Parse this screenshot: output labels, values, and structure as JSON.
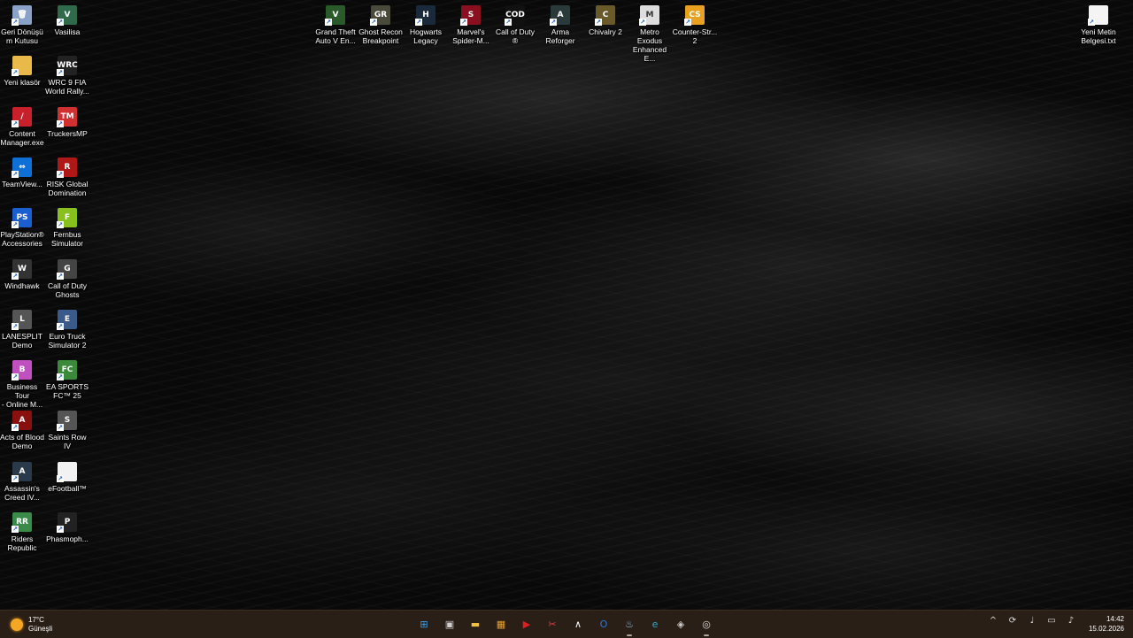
{
  "desktop_icons": [
    {
      "name": "recycle-bin-icon",
      "label": "Geri Dönüşü\nm Kutusu",
      "color": "#8aa2c8",
      "glyph": "🗑"
    },
    {
      "name": "vasilisa-icon",
      "label": "Vasilisa",
      "color": "#2f6b4a",
      "glyph": "V"
    },
    {
      "name": "folder-icon",
      "label": "Yeni klasör",
      "color": "#e9b949",
      "glyph": ""
    },
    {
      "name": "wrc9-icon",
      "label": "WRC 9 FIA\nWorld Rally...",
      "color": "#222",
      "glyph": "WRC"
    },
    {
      "name": "content-manager-icon",
      "label": "Content\nManager.exe",
      "color": "#c8202a",
      "glyph": "/"
    },
    {
      "name": "truckersmp-icon",
      "label": "TruckersMP",
      "color": "#d03030",
      "glyph": "TM"
    },
    {
      "name": "teamviewer-icon",
      "label": "TeamView...",
      "color": "#0e6fd6",
      "glyph": "⇔"
    },
    {
      "name": "risk-icon",
      "label": "RISK Global\nDomination",
      "color": "#b01818",
      "glyph": "R"
    },
    {
      "name": "playstation-accessories-icon",
      "label": "PlayStation®\nAccessories",
      "color": "#1a5fd0",
      "glyph": "PS"
    },
    {
      "name": "fernbus-icon",
      "label": "Fernbus\nSimulator",
      "color": "#88c020",
      "glyph": "F"
    },
    {
      "name": "windhawk-icon",
      "label": "Windhawk",
      "color": "#333",
      "glyph": "W"
    },
    {
      "name": "cod-ghosts-icon",
      "label": "Call of Duty\nGhosts",
      "color": "#444",
      "glyph": "G"
    },
    {
      "name": "lanesplit-icon",
      "label": "LANESPLIT\nDemo",
      "color": "#555",
      "glyph": "L"
    },
    {
      "name": "ets2-icon",
      "label": "Euro Truck\nSimulator 2",
      "color": "#3a5a8a",
      "glyph": "E"
    },
    {
      "name": "business-tour-icon",
      "label": "Business Tour\n- Online M...",
      "color": "#c050c0",
      "glyph": "B"
    },
    {
      "name": "ea-fc25-icon",
      "label": "EA SPORTS\nFC™ 25",
      "color": "#3a8a3a",
      "glyph": "FC"
    },
    {
      "name": "acts-of-blood-icon",
      "label": "Acts of Blood\nDemo",
      "color": "#8a1010",
      "glyph": "A"
    },
    {
      "name": "saints-row-icon",
      "label": "Saints Row IV",
      "color": "#555",
      "glyph": "S"
    },
    {
      "name": "assassins-creed-icon",
      "label": "Assassin's\nCreed IV...",
      "color": "#2a3a4a",
      "glyph": "A"
    },
    {
      "name": "efootball-icon",
      "label": "eFootball™",
      "color": "#f2f2f2",
      "glyph": ""
    },
    {
      "name": "riders-republic-icon",
      "label": "Riders\nRepublic",
      "color": "#3a8a4a",
      "glyph": "RR"
    },
    {
      "name": "phasmophobia-icon",
      "label": "Phasmoph...",
      "color": "#222",
      "glyph": "P"
    }
  ],
  "top_icons": [
    {
      "name": "gta5-icon",
      "label": "Grand Theft\nAuto V En...",
      "color": "#2a5a2a",
      "glyph": "V"
    },
    {
      "name": "ghost-recon-icon",
      "label": "Ghost Recon\nBreakpoint",
      "color": "#4a4a3a",
      "glyph": "GR"
    },
    {
      "name": "hogwarts-icon",
      "label": "Hogwarts\nLegacy",
      "color": "#1a2a3a",
      "glyph": "H"
    },
    {
      "name": "spiderman-icon",
      "label": "Marvel's\nSpider-M...",
      "color": "#8a1020",
      "glyph": "S"
    },
    {
      "name": "cod-icon",
      "label": "Call of Duty\n®",
      "color": "#111",
      "glyph": "COD"
    },
    {
      "name": "arma-icon",
      "label": "Arma\nReforger",
      "color": "#2a3a3a",
      "glyph": "A"
    },
    {
      "name": "chivalry-icon",
      "label": "Chivalry 2",
      "color": "#6a5a2a",
      "glyph": "C"
    },
    {
      "name": "metro-exodus-icon",
      "label": "Metro Exodus\nEnhanced E...",
      "color": "#ddd",
      "glyph": "M"
    },
    {
      "name": "cs2-icon",
      "label": "Counter-Str...\n2",
      "color": "#e8a020",
      "glyph": "CS"
    }
  ],
  "right_icons": [
    {
      "name": "text-file-icon",
      "label": "Yeni Metin\nBelgesi.txt",
      "color": "#f4f4f4",
      "glyph": ""
    }
  ],
  "taskbar": {
    "weather_temp": "17°C",
    "weather_desc": "Güneşli",
    "apps": [
      {
        "name": "start-button",
        "glyph": "⊞",
        "color": "#3aa0f0",
        "active": false
      },
      {
        "name": "task-view-icon",
        "glyph": "▣",
        "color": "#cfcfcf",
        "active": false
      },
      {
        "name": "file-explorer-icon",
        "glyph": "▬",
        "color": "#f0c040",
        "active": false
      },
      {
        "name": "microsoft-store-icon",
        "glyph": "▦",
        "color": "#e8a030",
        "active": false
      },
      {
        "name": "youtube-music-icon",
        "glyph": "▶",
        "color": "#e02020",
        "active": false
      },
      {
        "name": "snipping-tool-icon",
        "glyph": "✂",
        "color": "#d84040",
        "active": false
      },
      {
        "name": "arc-icon",
        "glyph": "∧",
        "color": "#ffffff",
        "active": false
      },
      {
        "name": "outlook-icon",
        "glyph": "O",
        "color": "#2a78d8",
        "active": false
      },
      {
        "name": "steam-icon",
        "glyph": "♨",
        "color": "#9ec4e8",
        "active": true
      },
      {
        "name": "edge-icon",
        "glyph": "e",
        "color": "#30a8d0",
        "active": false
      },
      {
        "name": "unity-hub-icon",
        "glyph": "◈",
        "color": "#cccccc",
        "active": false
      },
      {
        "name": "game-app-icon",
        "glyph": "◎",
        "color": "#dddddd",
        "active": true
      }
    ],
    "tray": [
      {
        "name": "show-hidden-icons-icon",
        "glyph": "^"
      },
      {
        "name": "sync-icon",
        "glyph": "⟳"
      },
      {
        "name": "microphone-icon",
        "glyph": "♩"
      },
      {
        "name": "network-icon",
        "glyph": "▭"
      },
      {
        "name": "volume-icon",
        "glyph": "♪"
      }
    ],
    "time": "14:42",
    "date": "15.02.2026"
  }
}
